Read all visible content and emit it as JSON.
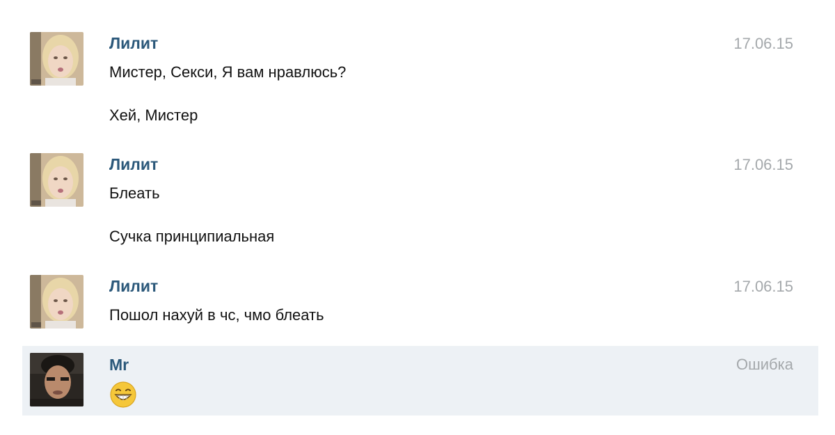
{
  "conversation": {
    "groups": [
      {
        "author": "Лилит",
        "date": "17.06.15",
        "avatar": "blonde-woman-avatar",
        "messages": [
          "Мистер, Секси, Я вам нравлюсь?",
          "Хей, Мистер"
        ]
      },
      {
        "author": "Лилит",
        "date": "17.06.15",
        "avatar": "blonde-woman-avatar",
        "messages": [
          "Блеать",
          "Сучка принципиальная"
        ]
      },
      {
        "author": "Лилит",
        "date": "17.06.15",
        "avatar": "blonde-woman-avatar",
        "messages": [
          "Пошол нахуй в чс, чмо блеать"
        ]
      },
      {
        "author": "Mr",
        "date": "Ошибка",
        "avatar": "dark-haired-man-avatar",
        "emoji": "grinning-face-emoji",
        "highlighted": true
      }
    ]
  },
  "colors": {
    "author": "#2b587a",
    "date": "#a4a8ab",
    "text": "#111111",
    "highlight_row": "#edf1f5",
    "emoji_yellow": "#f5c73a"
  }
}
